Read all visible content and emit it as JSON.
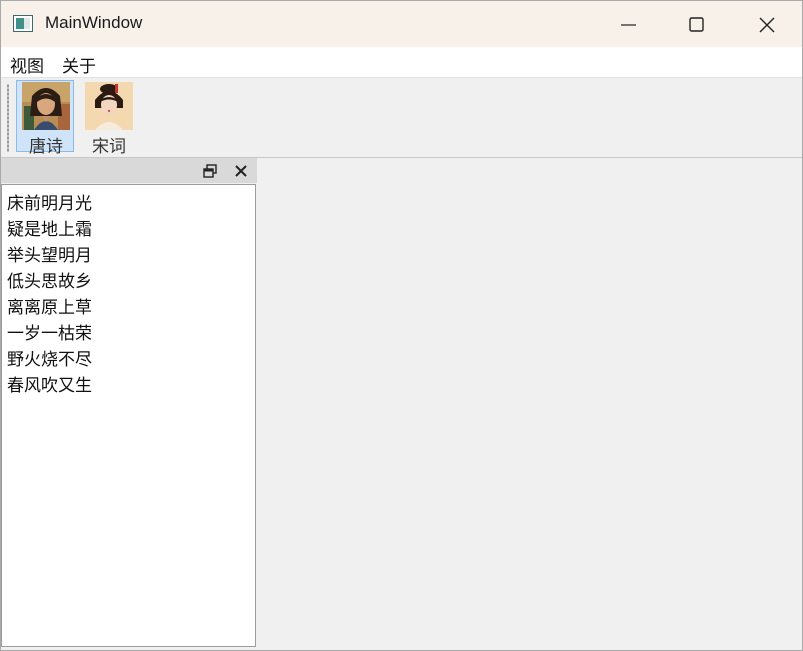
{
  "window": {
    "title": "MainWindow"
  },
  "menu": {
    "items": [
      "视图",
      "关于"
    ]
  },
  "toolbar": {
    "buttons": [
      {
        "label": "唐诗",
        "icon": "tang-poet-portrait-icon",
        "active": true
      },
      {
        "label": "宋词",
        "icon": "song-poet-portrait-icon",
        "active": false
      }
    ]
  },
  "dock": {
    "items": [
      "床前明月光",
      "疑是地上霜",
      "举头望明月",
      "低头思故乡",
      "离离原上草",
      "一岁一枯荣",
      "野火烧不尽",
      "春风吹又生"
    ]
  },
  "colors": {
    "titlebar": "#f7f1ea",
    "active_tool": "#cfe4f9",
    "background": "#f0f0f0"
  }
}
